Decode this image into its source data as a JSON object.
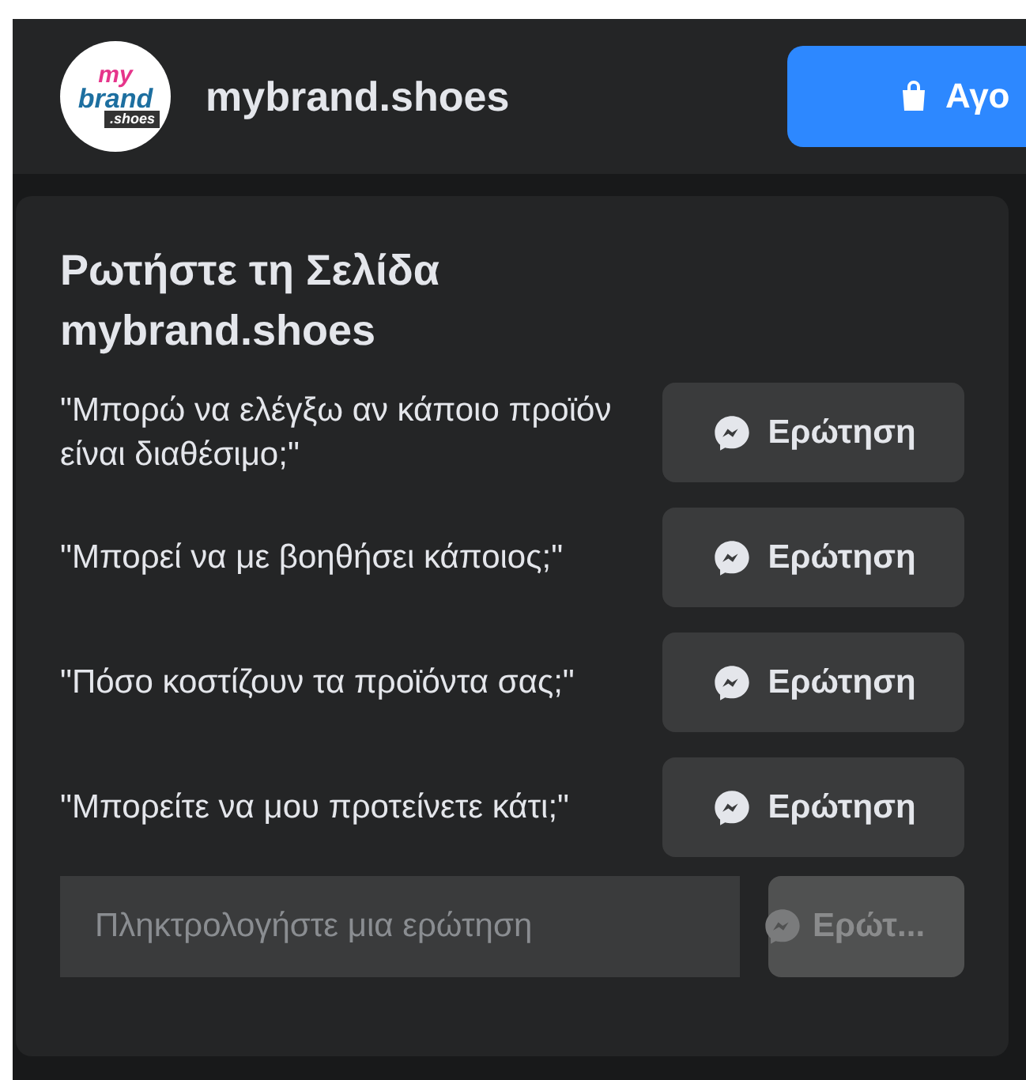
{
  "header": {
    "logo": {
      "line_1": "my",
      "line_2": "brand",
      "line_3": ".shoes"
    },
    "page_name": "mybrand.shoes",
    "shop_button": {
      "label": "Αγο"
    }
  },
  "card": {
    "title": "Ρωτήστε τη Σελίδα mybrand.shoes",
    "questions": [
      {
        "text": "\"Μπορώ να ελέγξω αν κάποιο προϊόν είναι διαθέσιμο;\"",
        "button": "Ερώτηση"
      },
      {
        "text": "\"Μπορεί να με βοηθήσει κάποιος;\"",
        "button": "Ερώτηση"
      },
      {
        "text": "\"Πόσο κοστίζουν τα προϊόντα σας;\"",
        "button": "Ερώτηση"
      },
      {
        "text": "\"Μπορείτε να μου προτείνετε κάτι;\"",
        "button": "Ερώτηση"
      }
    ],
    "input": {
      "placeholder": "Πληκτρολογήστε μια ερώτηση"
    },
    "send_button": {
      "label": "Ερώτ...",
      "disabled": true
    }
  }
}
